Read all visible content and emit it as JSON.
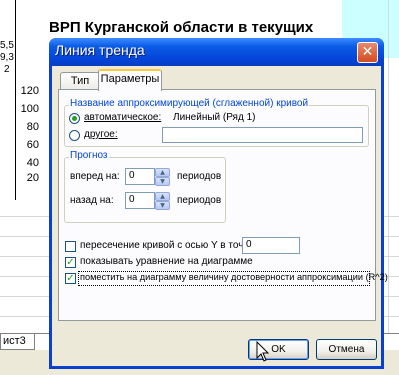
{
  "background": {
    "chart_title": "ВРП Курганской области в текущих",
    "row_labels": [
      "5,5",
      "9,3",
      "2"
    ],
    "y_ticks": [
      "120",
      "100",
      "80",
      "60",
      "40",
      "20"
    ],
    "sheet_tab": "ист3"
  },
  "dialog": {
    "title": "Линия тренда",
    "close_symbol": "✕",
    "tabs": [
      {
        "label": "Тип",
        "active": false
      },
      {
        "label": "Параметры",
        "active": true
      }
    ],
    "name_group": {
      "label": "Название аппроксимирующей (сглаженной) кривой",
      "auto_label": "автоматическое:",
      "auto_value": "Линейный (Ряд 1)",
      "other_label": "другое:",
      "other_value": ""
    },
    "forecast_group": {
      "label": "Прогноз",
      "forward_label": "вперед на:",
      "forward_value": "0",
      "forward_unit": "периодов",
      "back_label": "назад на:",
      "back_value": "0",
      "back_unit": "периодов"
    },
    "options": {
      "intercept_label": "пересечение кривой с осью Y в точке:",
      "intercept_value": "0",
      "intercept_checked": false,
      "show_equation_label": "показывать уравнение на диаграмме",
      "show_equation_checked": true,
      "show_r2_label": "поместить на диаграмму величину достоверности аппроксимации (R^2)",
      "show_r2_checked": true
    },
    "buttons": {
      "ok": "OK",
      "cancel": "Отмена"
    }
  },
  "colors": {
    "titlebar": "#0a5ce6",
    "client": "#ece9d8",
    "group_label": "#0046d5",
    "check": "#21a121"
  }
}
